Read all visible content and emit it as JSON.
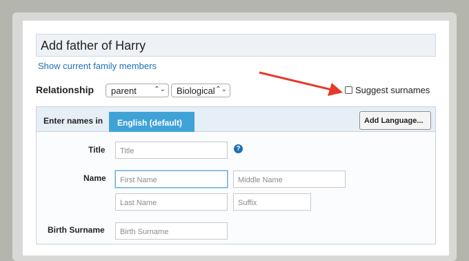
{
  "dialog": {
    "title": "Add father of Harry",
    "family_link": "Show current family members"
  },
  "relationship": {
    "label": "Relationship",
    "type_value": "parent",
    "kind_value": "Biological",
    "suggest_label": "Suggest surnames"
  },
  "names": {
    "enter_label": "Enter names in",
    "language_tab": "English (default)",
    "add_language": "Add Language...",
    "title_label": "Title",
    "title_placeholder": "Title",
    "name_label": "Name",
    "first_placeholder": "First Name",
    "middle_placeholder": "Middle Name",
    "last_placeholder": "Last Name",
    "suffix_placeholder": "Suffix",
    "birth_label": "Birth Surname",
    "birth_placeholder": "Birth Surname",
    "help_glyph": "?"
  },
  "colors": {
    "accent": "#3fa3d8",
    "link": "#1f6fb2",
    "arrow": "#e8382a"
  },
  "icons": {
    "chevron": "chevron-updown-icon",
    "help": "question-icon",
    "arrow": "red-arrow-annotation"
  }
}
